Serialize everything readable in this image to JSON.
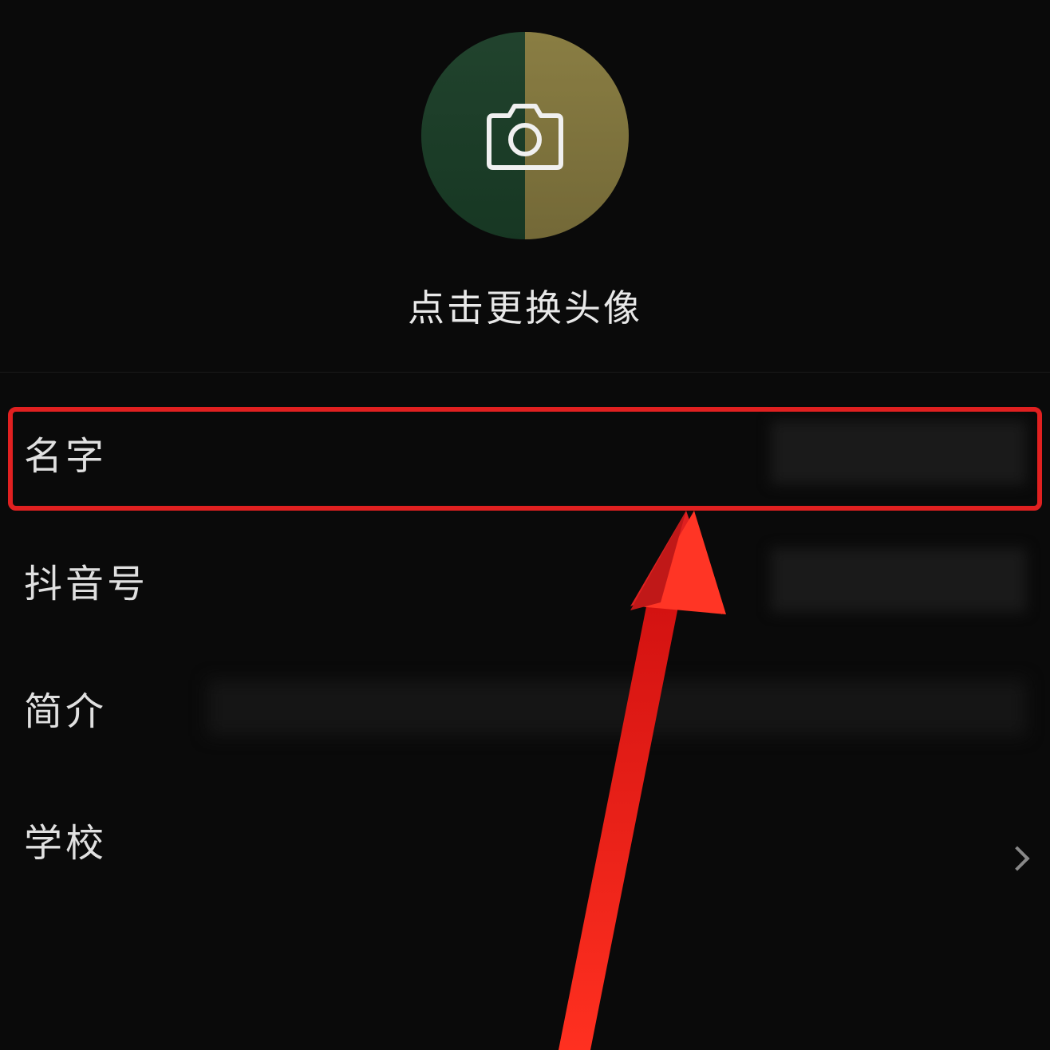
{
  "avatar": {
    "change_label": "点击更换头像",
    "camera_icon": "camera-icon"
  },
  "form": {
    "name": {
      "label": "名字"
    },
    "douyin_id": {
      "label": "抖音号"
    },
    "bio": {
      "label": "简介"
    },
    "school": {
      "label": "学校"
    }
  },
  "annotation": {
    "highlight_color": "#e02020"
  }
}
